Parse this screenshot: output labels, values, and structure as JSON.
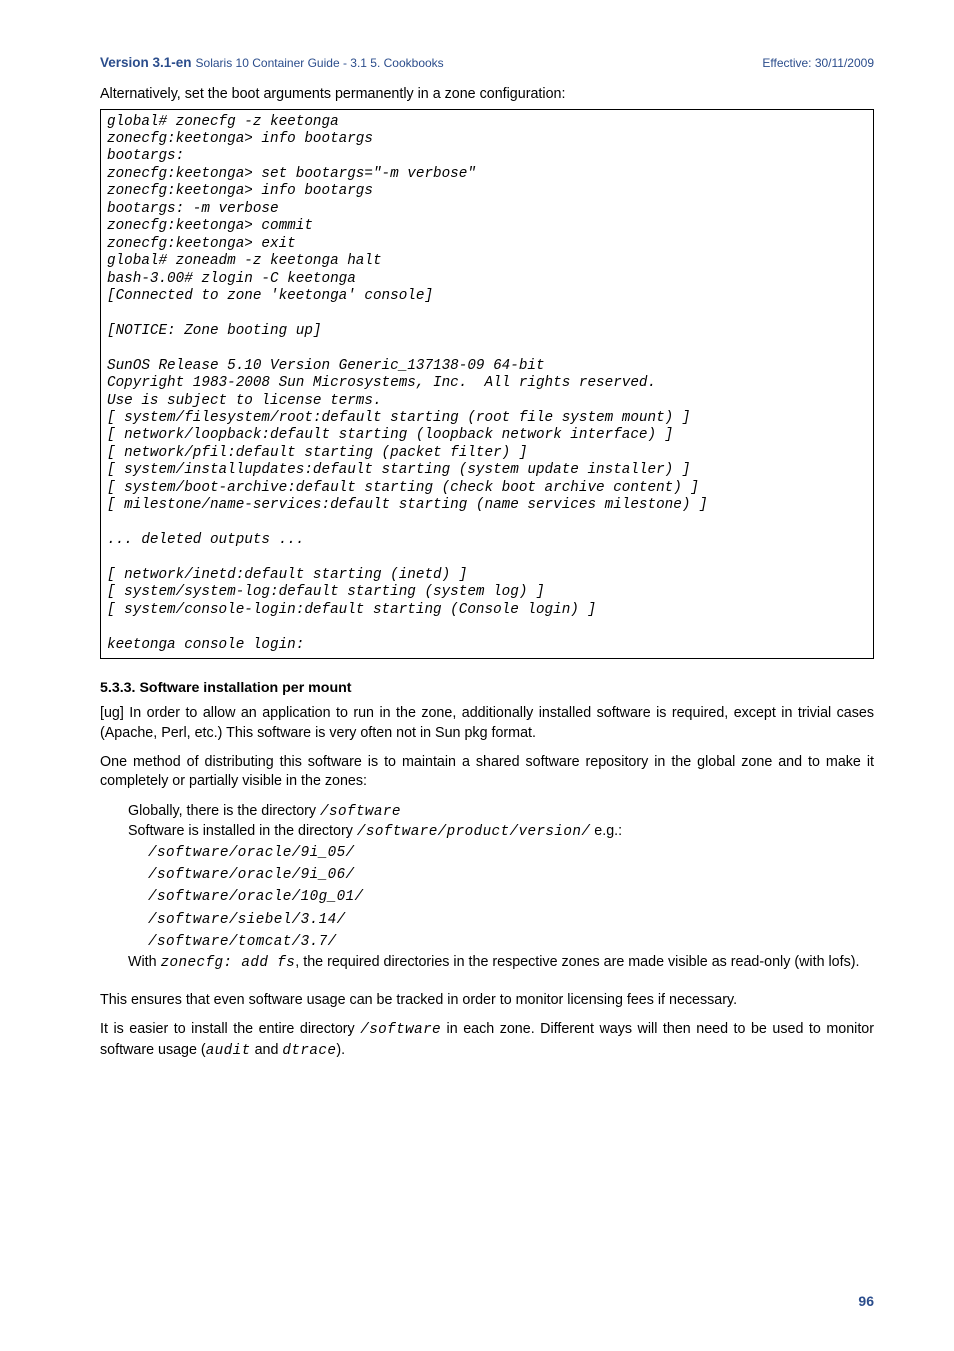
{
  "header": {
    "version": "Version 3.1-en",
    "subtitle": "Solaris 10 Container Guide - 3.1   5. Cookbooks",
    "effective": "Effective: 30/11/2009"
  },
  "intro": "Alternatively, set the boot arguments permanently in a zone configuration:",
  "code": "global# zonecfg -z keetonga \nzonecfg:keetonga> info bootargs \nbootargs: \nzonecfg:keetonga> set bootargs=\"-m verbose\" \nzonecfg:keetonga> info bootargs \nbootargs: -m verbose \nzonecfg:keetonga> commit \nzonecfg:keetonga> exit \nglobal# zoneadm -z keetonga halt \nbash-3.00# zlogin -C keetonga \n[Connected to zone 'keetonga' console] \n\n[NOTICE: Zone booting up] \n\nSunOS Release 5.10 Version Generic_137138-09 64-bit \nCopyright 1983-2008 Sun Microsystems, Inc.  All rights reserved. \nUse is subject to license terms. \n[ system/filesystem/root:default starting (root file system mount) ] \n[ network/loopback:default starting (loopback network interface) ] \n[ network/pfil:default starting (packet filter) ] \n[ system/installupdates:default starting (system update installer) ] \n[ system/boot-archive:default starting (check boot archive content) ] \n[ milestone/name-services:default starting (name services milestone) ]\n\n... deleted outputs ... \n\n[ network/inetd:default starting (inetd) ] \n[ system/system-log:default starting (system log) ] \n[ system/console-login:default starting (Console login) ] \n\nkeetonga console login: ",
  "section": {
    "number": "5.3.3.",
    "title": "Software installation per mount"
  },
  "para1": "[ug] In order to allow an application to run in the zone, additionally installed software is required, except in trivial cases (Apache, Perl, etc.) This software is very often not in Sun pkg format.",
  "para2": "One method of distributing this software is to maintain a shared software repository in the global zone and to make it completely or partially visible in the zones:",
  "list": {
    "l1a": "Globally, there is the directory ",
    "l1b": "/software",
    "l2a": "Software is installed in the directory ",
    "l2b": "/software/product/version/",
    "l2c": " e.g.:",
    "paths": [
      "/software/oracle/9i_05/",
      "/software/oracle/9i_06/",
      "/software/oracle/10g_01/",
      "/software/siebel/3.14/",
      "/software/tomcat/3.7/"
    ],
    "l3a": "With ",
    "l3b": "zonecfg: add fs",
    "l3c": ", the required directories in the respective zones are made visible as read-only (with lofs)."
  },
  "para3": "This ensures that even software usage can be tracked in order to monitor licensing fees if necessary.",
  "para4a": "It is easier to install the entire directory ",
  "para4b": "/software",
  "para4c": " in each zone. Different ways will then need to be used to monitor software usage (",
  "para4d": "audit",
  "para4e": " and ",
  "para4f": "dtrace",
  "para4g": ").",
  "page_number": "96"
}
